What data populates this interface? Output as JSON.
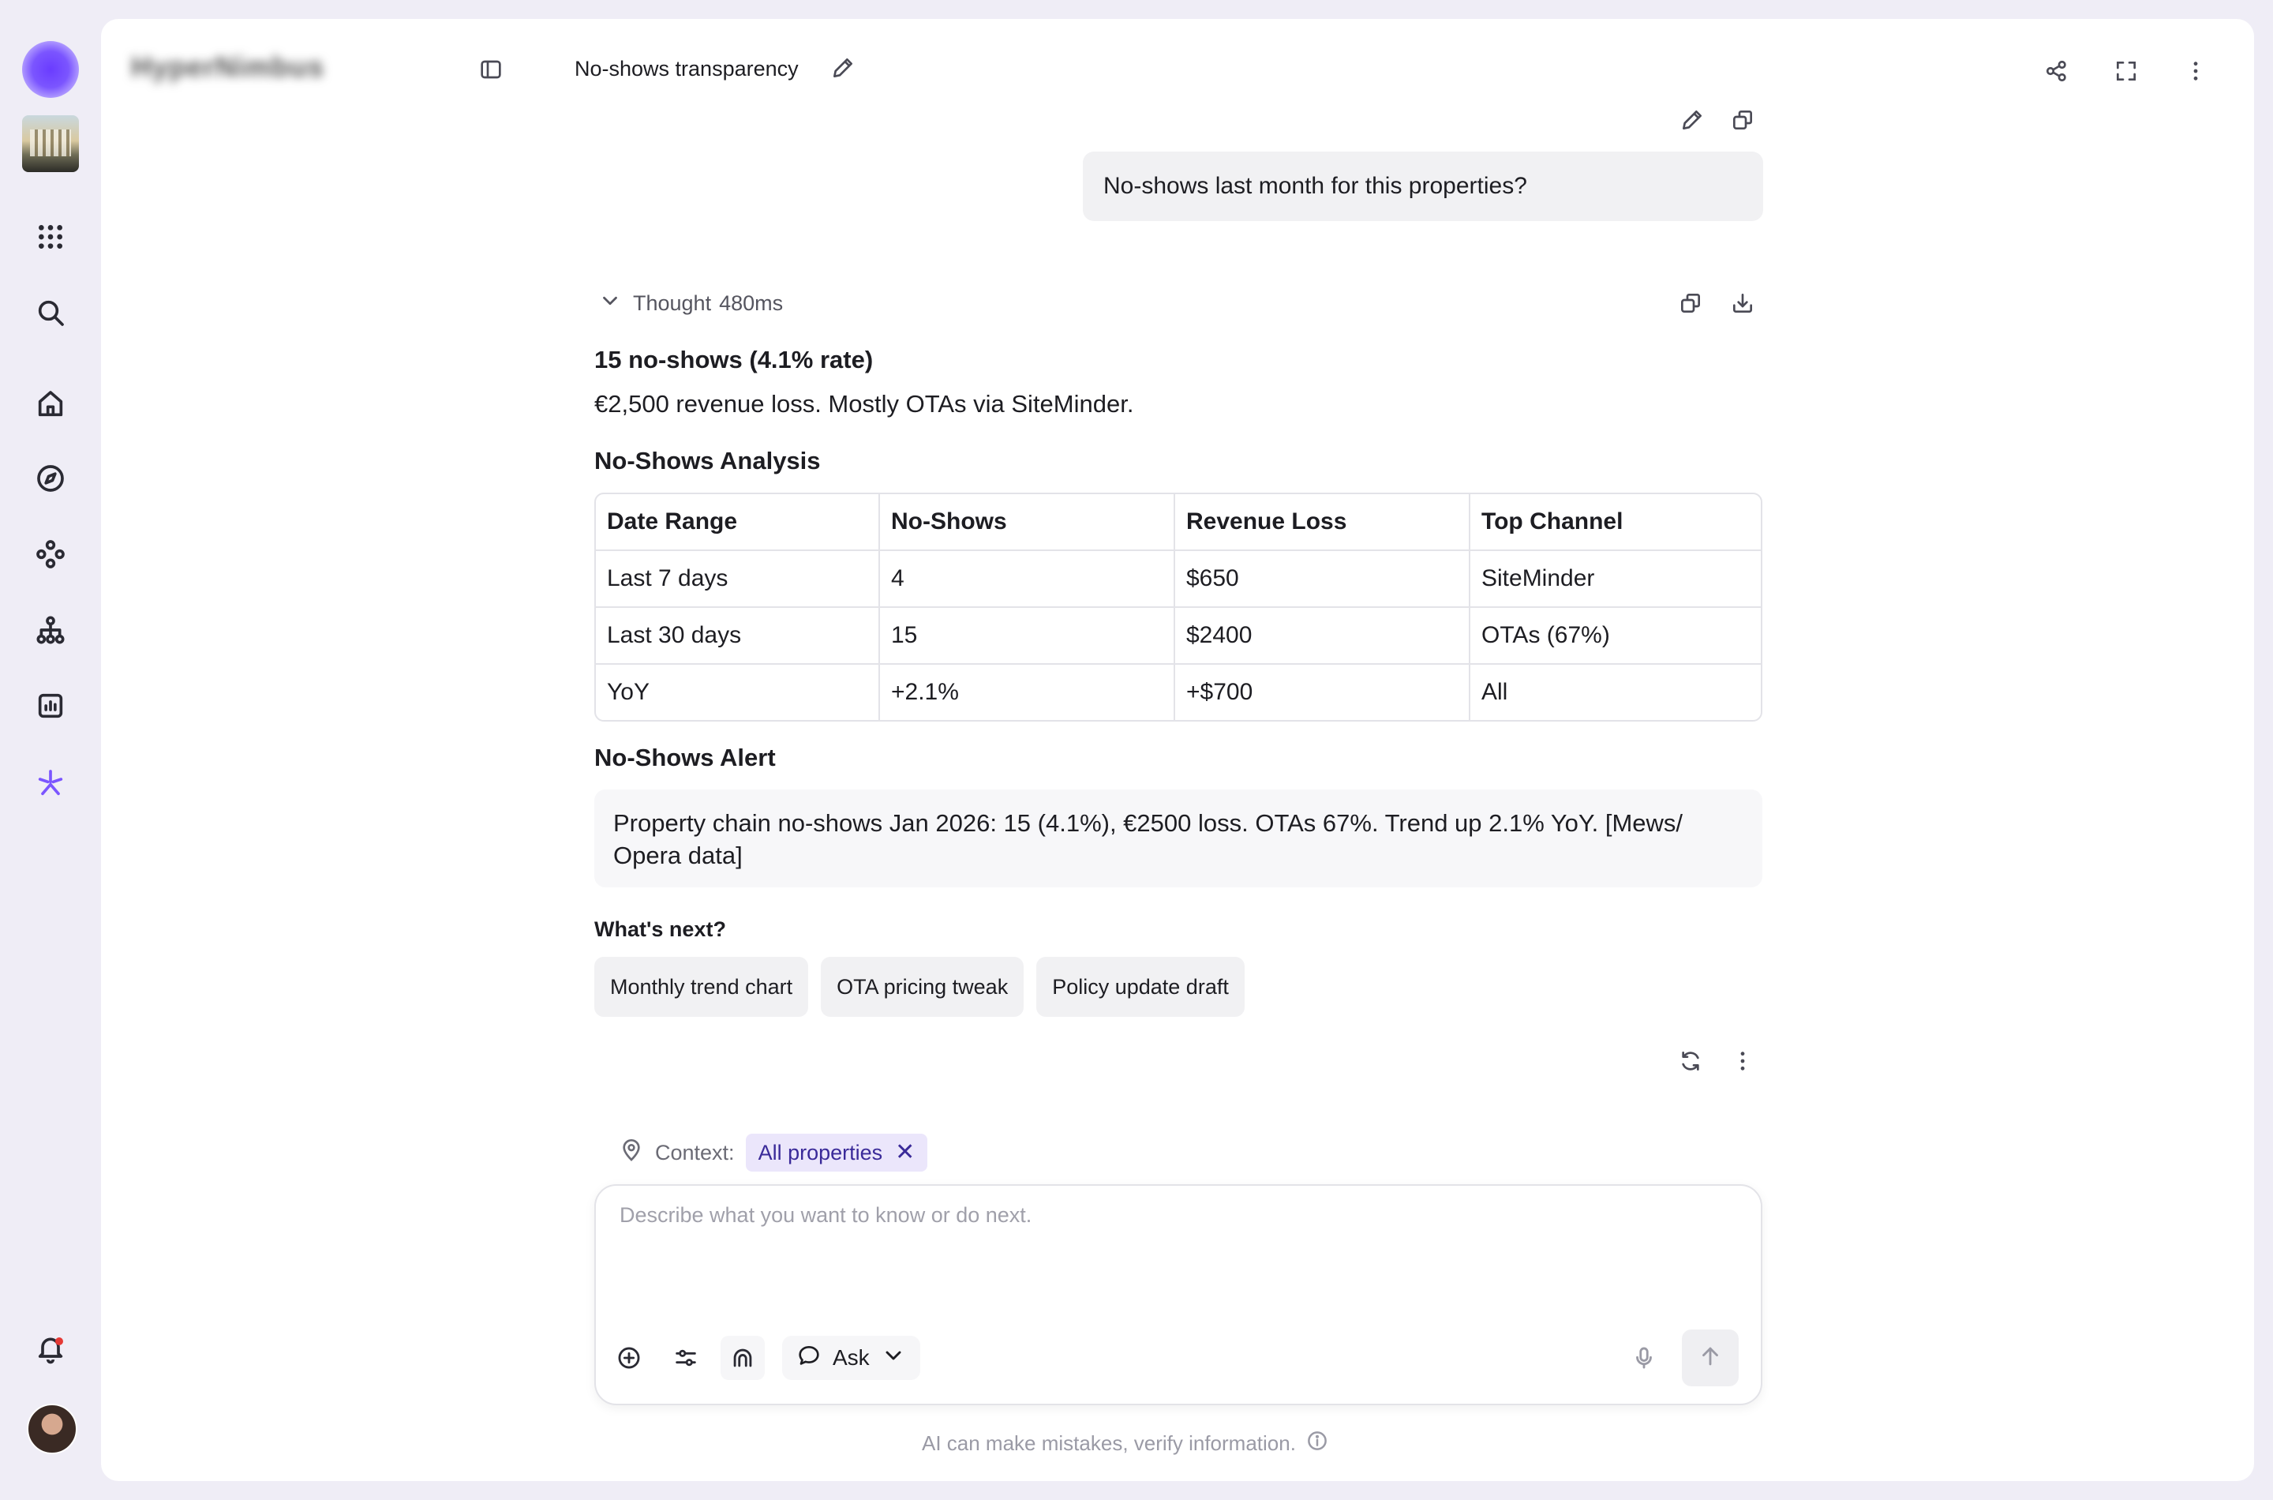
{
  "app": {
    "brand": "HyperNimbus"
  },
  "header": {
    "chat_title": "No-shows transparency"
  },
  "user_message": "No-shows last month for this properties?",
  "thought": {
    "label": "Thought",
    "duration": "480ms"
  },
  "answer": {
    "headline": "15 no-shows (4.1% rate)",
    "summary": "€2,500 revenue loss. Mostly OTAs via SiteMinder."
  },
  "analysis": {
    "title": "No-Shows Analysis",
    "columns": [
      "Date Range",
      "No-Shows",
      "Revenue Loss",
      "Top Channel"
    ],
    "rows": [
      [
        "Last 7 days",
        "4",
        "$650",
        "SiteMinder"
      ],
      [
        "Last 30 days",
        "15",
        "$2400",
        "OTAs (67%)"
      ],
      [
        "YoY",
        "+2.1%",
        "+$700",
        "All"
      ]
    ]
  },
  "alert": {
    "title": "No-Shows Alert",
    "text": "Property chain no-shows Jan 2026: 15 (4.1%), €2500 loss. OTAs 67%. Trend up 2.1% YoY. [Mews/ Opera data]"
  },
  "next": {
    "label": "What's next?",
    "chips": [
      "Monthly trend chart",
      "OTA pricing tweak",
      "Policy update draft"
    ]
  },
  "composer": {
    "context_label": "Context:",
    "context_value": "All properties",
    "placeholder": "Describe what you want to know or do next.",
    "value": "",
    "mode": "Ask"
  },
  "disclaimer": "AI can make mistakes, verify information.",
  "colors": {
    "accent": "#6a3cff",
    "chip_bg": "#ebe6fb",
    "chip_text": "#3a2a99",
    "notification": "#e53935"
  }
}
